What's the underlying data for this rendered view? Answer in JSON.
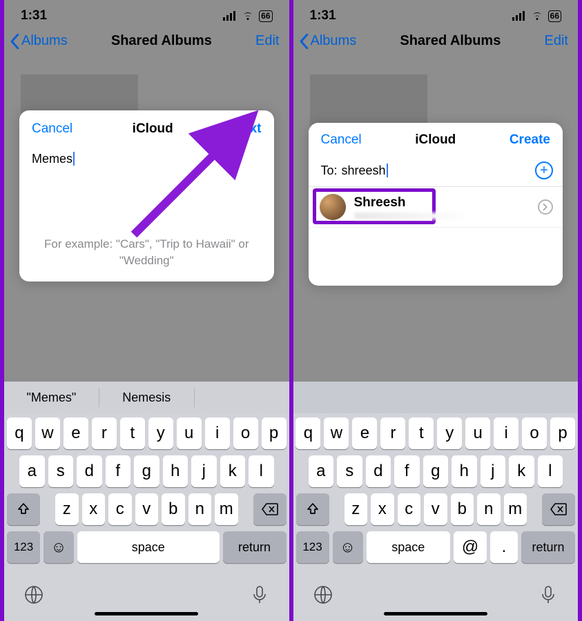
{
  "status": {
    "time": "1:31",
    "battery": "66"
  },
  "nav": {
    "back": "Albums",
    "title": "Shared Albums",
    "edit": "Edit"
  },
  "screen1": {
    "cancel": "Cancel",
    "title": "iCloud",
    "next": "Next",
    "input_value": "Memes",
    "hint": "For example: \"Cars\", \"Trip to Hawaii\" or \"Wedding\"",
    "suggestions": [
      "\"Memes\"",
      "Nemesis"
    ]
  },
  "screen2": {
    "cancel": "Cancel",
    "title": "iCloud",
    "create": "Create",
    "to_label": "To:",
    "to_value": "shreesh",
    "contact_name": "Shreesh"
  },
  "keyboard": {
    "row1": [
      "q",
      "w",
      "e",
      "r",
      "t",
      "y",
      "u",
      "i",
      "o",
      "p"
    ],
    "row2": [
      "a",
      "s",
      "d",
      "f",
      "g",
      "h",
      "j",
      "k",
      "l"
    ],
    "row3": [
      "z",
      "x",
      "c",
      "v",
      "b",
      "n",
      "m"
    ],
    "num": "123",
    "space": "space",
    "return": "return",
    "at": "@",
    "dot": "."
  }
}
